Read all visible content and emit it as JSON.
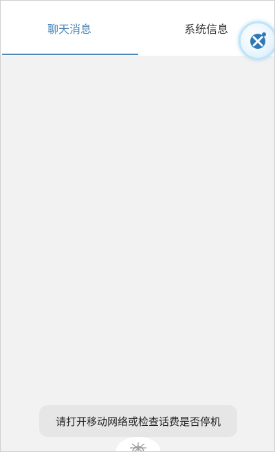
{
  "tabs": [
    {
      "label": "聊天消息",
      "selected": true
    },
    {
      "label": "系统信息",
      "selected": false
    }
  ],
  "colors": {
    "accent": "#4a86b8",
    "content_background": "#f2f2f2",
    "toast_background": "#e6e6e6"
  },
  "toast": {
    "message": "请打开移动网络或检查话费是否停机"
  },
  "icons": {
    "floating_button": "dot-cross-icon",
    "bottom_handle": "ship-helm-icon"
  }
}
